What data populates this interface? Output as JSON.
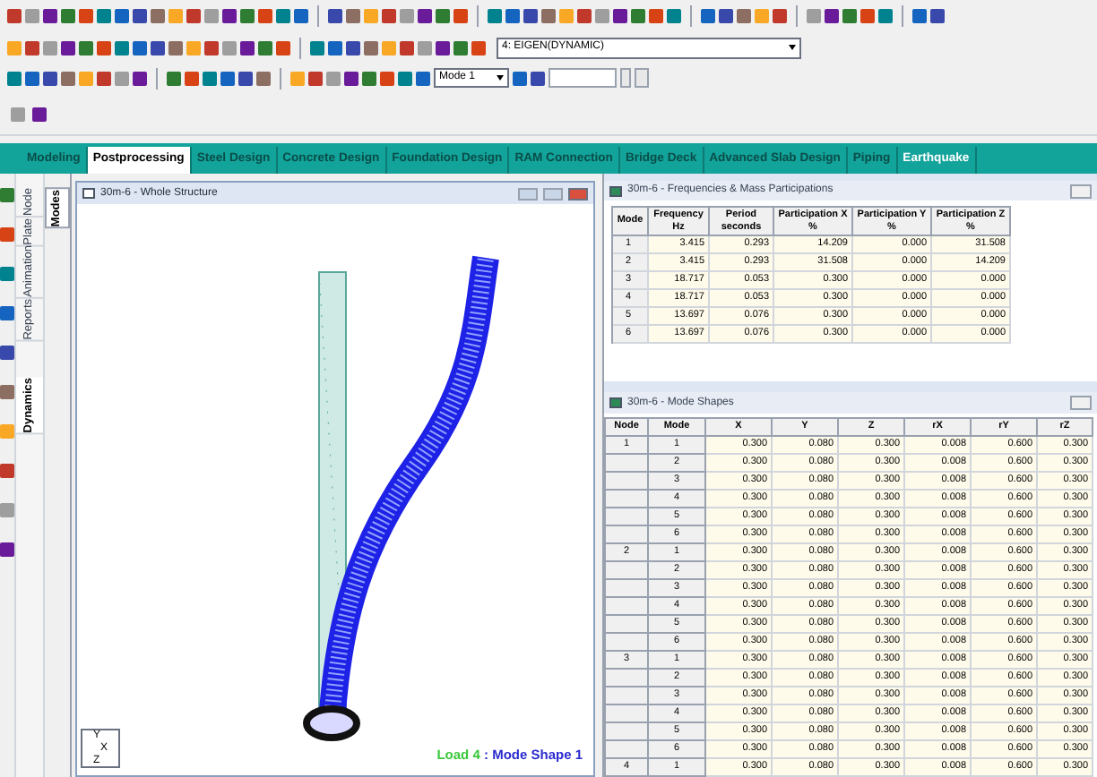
{
  "toolbar": {
    "load_case": "4: EIGEN(DYNAMIC)",
    "mode": "Mode 1"
  },
  "tabs": [
    {
      "label": "Modeling",
      "selected": false,
      "kind": "module"
    },
    {
      "label": "Postprocessing",
      "selected": true,
      "kind": "module"
    },
    {
      "label": "Steel Design",
      "selected": false,
      "kind": "module"
    },
    {
      "label": "Concrete Design",
      "selected": false,
      "kind": "module"
    },
    {
      "label": "Foundation Design",
      "selected": false,
      "kind": "module"
    },
    {
      "label": "RAM Connection",
      "selected": false,
      "kind": "module"
    },
    {
      "label": "Bridge Deck",
      "selected": false,
      "kind": "module"
    },
    {
      "label": "Advanced Slab Design",
      "selected": false,
      "kind": "module"
    },
    {
      "label": "Piping",
      "selected": false,
      "kind": "module"
    },
    {
      "label": "Earthquake",
      "selected": false,
      "kind": "addon"
    }
  ],
  "side_tabs": [
    {
      "label": "Node",
      "selected": false
    },
    {
      "label": "Plate",
      "selected": false
    },
    {
      "label": "Animation",
      "selected": false
    },
    {
      "label": "Reports",
      "selected": false
    },
    {
      "label": "Dynamics",
      "selected": true
    }
  ],
  "sub_tabs": [
    {
      "label": "Modes",
      "selected": true
    }
  ],
  "view": {
    "title": "30m-6 - Whole Structure",
    "caption_load": "Load 4",
    "caption_mode": ": Mode Shape 1",
    "axis_labels": [
      "Y",
      "X",
      "Z"
    ]
  },
  "frequencies": {
    "title": "30m-6 - Frequencies & Mass Participations",
    "columns": [
      "Mode",
      "Frequency\nHz",
      "Period\nseconds",
      "Participation X\n%",
      "Participation Y\n%",
      "Participation Z\n%"
    ],
    "rows": [
      [
        "1",
        "3.415",
        "0.293",
        "14.209",
        "0.000",
        "31.508"
      ],
      [
        "2",
        "3.415",
        "0.293",
        "31.508",
        "0.000",
        "14.209"
      ],
      [
        "3",
        "18.717",
        "0.053",
        "0.300",
        "0.000",
        "0.000"
      ],
      [
        "4",
        "18.717",
        "0.053",
        "0.300",
        "0.000",
        "0.000"
      ],
      [
        "5",
        "13.697",
        "0.076",
        "0.300",
        "0.000",
        "0.000"
      ],
      [
        "6",
        "13.697",
        "0.076",
        "0.300",
        "0.000",
        "0.000"
      ]
    ]
  },
  "mode_shapes": {
    "title": "30m-6 - Mode Shapes",
    "columns": [
      "Node",
      "Mode",
      "X",
      "Y",
      "Z",
      "rX",
      "rY",
      "rZ"
    ],
    "rows": [
      {
        "node": "1",
        "mode": "1",
        "values": [
          "0.300",
          "0.080",
          "0.300",
          "0.008",
          "0.600",
          "0.300"
        ]
      },
      {
        "mode": "2",
        "values": [
          "0.300",
          "0.080",
          "0.300",
          "0.008",
          "0.600",
          "0.300"
        ]
      },
      {
        "mode": "3",
        "values": [
          "0.300",
          "0.080",
          "0.300",
          "0.008",
          "0.600",
          "0.300"
        ]
      },
      {
        "mode": "4",
        "values": [
          "0.300",
          "0.080",
          "0.300",
          "0.008",
          "0.600",
          "0.300"
        ]
      },
      {
        "mode": "5",
        "values": [
          "0.300",
          "0.080",
          "0.300",
          "0.008",
          "0.600",
          "0.300"
        ]
      },
      {
        "mode": "6",
        "values": [
          "0.300",
          "0.080",
          "0.300",
          "0.008",
          "0.600",
          "0.300"
        ]
      },
      {
        "node": "2",
        "mode": "1",
        "values": [
          "0.300",
          "0.080",
          "0.300",
          "0.008",
          "0.600",
          "0.300"
        ]
      },
      {
        "mode": "2",
        "values": [
          "0.300",
          "0.080",
          "0.300",
          "0.008",
          "0.600",
          "0.300"
        ]
      },
      {
        "mode": "3",
        "values": [
          "0.300",
          "0.080",
          "0.300",
          "0.008",
          "0.600",
          "0.300"
        ]
      },
      {
        "mode": "4",
        "values": [
          "0.300",
          "0.080",
          "0.300",
          "0.008",
          "0.600",
          "0.300"
        ]
      },
      {
        "mode": "5",
        "values": [
          "0.300",
          "0.080",
          "0.300",
          "0.008",
          "0.600",
          "0.300"
        ]
      },
      {
        "mode": "6",
        "values": [
          "0.300",
          "0.080",
          "0.300",
          "0.008",
          "0.600",
          "0.300"
        ]
      },
      {
        "node": "3",
        "mode": "1",
        "values": [
          "0.300",
          "0.080",
          "0.300",
          "0.008",
          "0.600",
          "0.300"
        ]
      },
      {
        "mode": "2",
        "values": [
          "0.300",
          "0.080",
          "0.300",
          "0.008",
          "0.600",
          "0.300"
        ]
      },
      {
        "mode": "3",
        "values": [
          "0.300",
          "0.080",
          "0.300",
          "0.008",
          "0.600",
          "0.300"
        ]
      },
      {
        "mode": "4",
        "values": [
          "0.300",
          "0.080",
          "0.300",
          "0.008",
          "0.600",
          "0.300"
        ]
      },
      {
        "mode": "5",
        "values": [
          "0.300",
          "0.080",
          "0.300",
          "0.008",
          "0.600",
          "0.300"
        ]
      },
      {
        "mode": "6",
        "values": [
          "0.300",
          "0.080",
          "0.300",
          "0.008",
          "0.600",
          "0.300"
        ]
      },
      {
        "node": "4",
        "mode": "1",
        "values": [
          "0.300",
          "0.080",
          "0.300",
          "0.008",
          "0.600",
          "0.300"
        ]
      }
    ]
  }
}
